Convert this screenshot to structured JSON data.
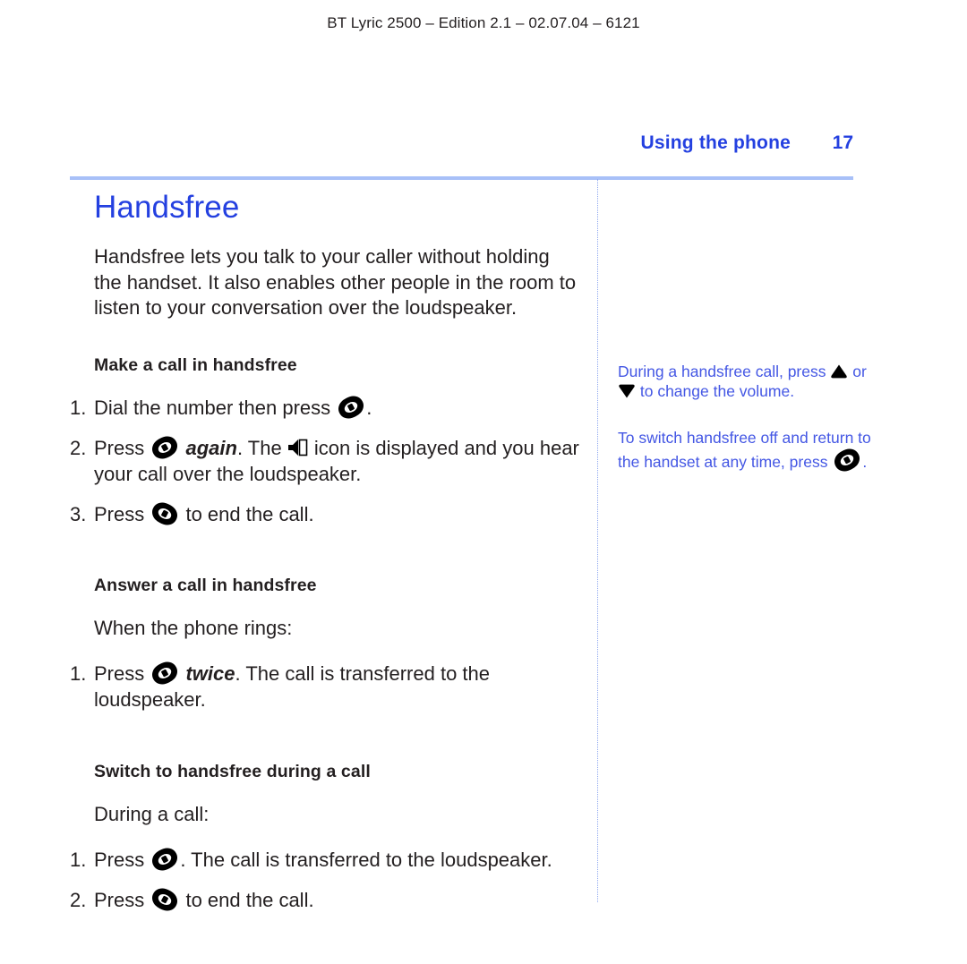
{
  "running_header": "BT Lyric 2500 – Edition 2.1 – 02.07.04 – 6121",
  "page_header": {
    "section": "Using the phone",
    "page_number": "17"
  },
  "colors": {
    "heading_blue": "#2440e0",
    "rule_blue": "#a8c0f8",
    "side_note_blue": "#4457e4",
    "body_black": "#231f20"
  },
  "main": {
    "title": "Handsfree",
    "intro": "Handsfree lets you talk to your caller without holding the handset. It also enables other people in the room to listen to your conversation over the loudspeaker.",
    "sections": [
      {
        "heading": "Make a call in handsfree",
        "lead": "",
        "steps": [
          {
            "number": "1.",
            "parts": [
              {
                "type": "text",
                "value": "Dial the number then press "
              },
              {
                "type": "icon",
                "value": "talk-handset-icon"
              },
              {
                "type": "text",
                "value": "."
              }
            ]
          },
          {
            "number": "2.",
            "parts": [
              {
                "type": "text",
                "value": "Press "
              },
              {
                "type": "icon",
                "value": "talk-handset-icon"
              },
              {
                "type": "bold-italic",
                "value": " again"
              },
              {
                "type": "text",
                "value": ". The "
              },
              {
                "type": "icon",
                "value": "loudspeaker-icon"
              },
              {
                "type": "text",
                "value": " icon is displayed and you hear your call over the loudspeaker."
              }
            ]
          },
          {
            "number": "3.",
            "parts": [
              {
                "type": "text",
                "value": "Press "
              },
              {
                "type": "icon",
                "value": "end-call-handset-icon"
              },
              {
                "type": "text",
                "value": " to end the call."
              }
            ]
          }
        ]
      },
      {
        "heading": "Answer a call in handsfree",
        "lead": "When the phone rings:",
        "steps": [
          {
            "number": "1.",
            "parts": [
              {
                "type": "text",
                "value": "Press "
              },
              {
                "type": "icon",
                "value": "talk-handset-icon"
              },
              {
                "type": "bold-italic",
                "value": " twice"
              },
              {
                "type": "text",
                "value": ". The call is transferred to the loudspeaker."
              }
            ]
          }
        ]
      },
      {
        "heading": "Switch to handsfree during a call",
        "lead": "During a call:",
        "steps": [
          {
            "number": "1.",
            "parts": [
              {
                "type": "text",
                "value": "Press "
              },
              {
                "type": "icon",
                "value": "talk-handset-icon"
              },
              {
                "type": "text",
                "value": ". The call is transferred to the loudspeaker."
              }
            ]
          },
          {
            "number": "2.",
            "parts": [
              {
                "type": "text",
                "value": "Press "
              },
              {
                "type": "icon",
                "value": "end-call-handset-icon"
              },
              {
                "type": "text",
                "value": " to end the call."
              }
            ]
          }
        ]
      }
    ]
  },
  "side_notes": [
    {
      "parts": [
        {
          "type": "text",
          "value": "During a handsfree call, press "
        },
        {
          "type": "icon",
          "value": "volume-up-icon"
        },
        {
          "type": "text",
          "value": " or "
        },
        {
          "type": "icon",
          "value": "volume-down-icon"
        },
        {
          "type": "text",
          "value": " to change the volume."
        }
      ]
    },
    {
      "parts": [
        {
          "type": "text",
          "value": "To switch handsfree off and return to the handset at any time, press "
        },
        {
          "type": "icon",
          "value": "talk-handset-icon"
        },
        {
          "type": "text",
          "value": "."
        }
      ]
    }
  ]
}
